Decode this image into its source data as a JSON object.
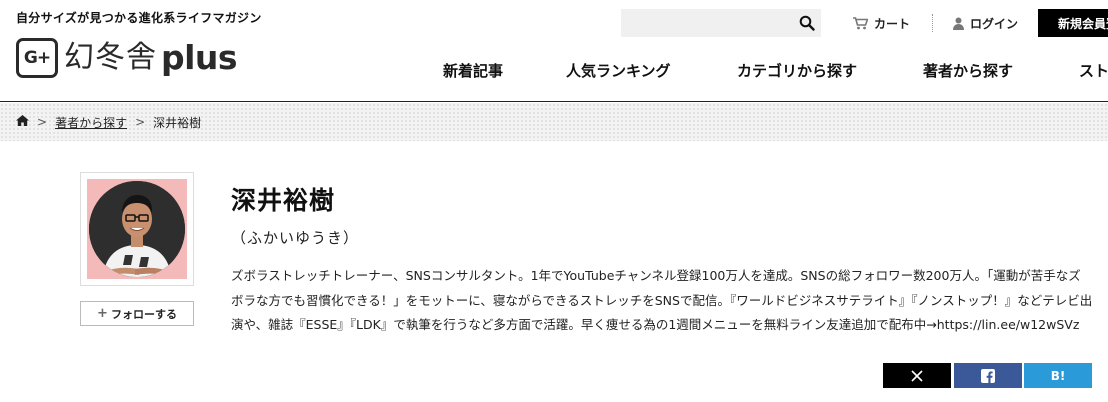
{
  "header": {
    "tagline": "自分サイズが見つかる進化系ライフマガジン",
    "logo_mark": "G+",
    "logo_jp": "幻冬舎",
    "logo_plus": "plus",
    "search_placeholder": "",
    "cart_label": "カート",
    "login_label": "ログイン",
    "signup_label": "新規会員登録"
  },
  "nav": [
    "新着記事",
    "人気ランキング",
    "カテゴリから探す",
    "著者から探す",
    "ストア"
  ],
  "breadcrumb": {
    "home_icon": "home-icon",
    "items": [
      "著者から探す",
      "深井裕樹"
    ]
  },
  "author": {
    "name": "深井裕樹",
    "kana": "（ふかいゆうき）",
    "follow_label": "フォローする",
    "bio": "ズボラストレッチトレーナー、SNSコンサルタント。1年でYouTubeチャンネル登録100万人を達成。SNSの総フォロワー数200万人。「運動が苦手なズボラな方でも習慣化できる！」をモットーに、寝ながらできるストレッチをSNSで配信。『ワールドビジネスサテライト』『ノンストップ！』などテレビ出演や、雑誌『ESSE』『LDK』で執筆を行うなど多方面で活躍。早く痩せる為の1週間メニューを無料ライン友達追加で配布中→https://lin.ee/w12wSVz"
  },
  "share": {
    "x_icon": "x-icon",
    "facebook_icon": "facebook-icon",
    "hatena_label": "B!"
  },
  "colors": {
    "facebook": "#3b5998",
    "hatena": "#2a9ad9",
    "avatar_bg": "#f4b9b9"
  }
}
